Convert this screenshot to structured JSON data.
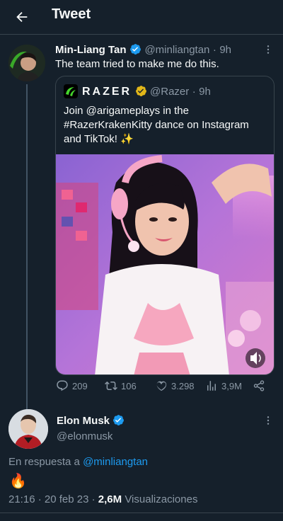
{
  "header": {
    "title": "Tweet"
  },
  "reply_tweet": {
    "name": "Min-Liang Tan",
    "handle": "@minliangtan",
    "separator": "·",
    "time": "9h",
    "text": "The team tried to make me do this."
  },
  "quoted_tweet": {
    "brand": "RAZER",
    "handle": "@Razer",
    "separator": "·",
    "time": "9h",
    "text_line1": "Join @arigameplays in the",
    "text_line2": "#RazerKrakenKitty dance on Instagram",
    "text_line3": "and TikTok! ✨"
  },
  "actions": {
    "replies": "209",
    "retweets": "106",
    "likes": "3.298",
    "views": "3,9M"
  },
  "main_tweet": {
    "name": "Elon Musk",
    "handle": "@elonmusk",
    "reply_prefix": "En respuesta a",
    "reply_to": "@minliangtan",
    "text": "🔥",
    "time": "21:16",
    "date_separator": "·",
    "date": "20 feb 23",
    "views_count": "2,6M",
    "views_label": "Visualizaciones"
  },
  "colors": {
    "background": "#15202b",
    "accent": "#1d9bf0",
    "verified_blue": "#1d9bf0",
    "verified_gold": "#e2b719",
    "muted": "#8b98a5",
    "razer_green": "#44d62c"
  }
}
